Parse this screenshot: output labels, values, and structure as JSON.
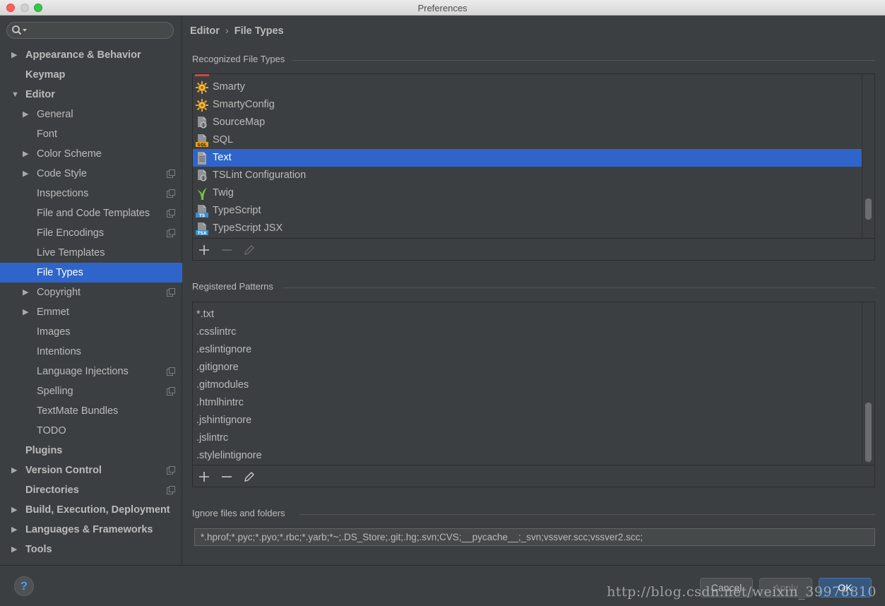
{
  "window": {
    "title": "Preferences"
  },
  "search": {
    "placeholder": ""
  },
  "sidebar": {
    "items": [
      {
        "label": "Appearance & Behavior",
        "level": 0,
        "bold": true,
        "arrow": "right",
        "proj": false
      },
      {
        "label": "Keymap",
        "level": 0,
        "bold": true,
        "arrow": "",
        "proj": false
      },
      {
        "label": "Editor",
        "level": 0,
        "bold": true,
        "arrow": "down",
        "proj": false
      },
      {
        "label": "General",
        "level": 1,
        "bold": false,
        "arrow": "right",
        "proj": false
      },
      {
        "label": "Font",
        "level": 1,
        "bold": false,
        "arrow": "",
        "proj": false
      },
      {
        "label": "Color Scheme",
        "level": 1,
        "bold": false,
        "arrow": "right",
        "proj": false
      },
      {
        "label": "Code Style",
        "level": 1,
        "bold": false,
        "arrow": "right",
        "proj": true
      },
      {
        "label": "Inspections",
        "level": 1,
        "bold": false,
        "arrow": "",
        "proj": true
      },
      {
        "label": "File and Code Templates",
        "level": 1,
        "bold": false,
        "arrow": "",
        "proj": true
      },
      {
        "label": "File Encodings",
        "level": 1,
        "bold": false,
        "arrow": "",
        "proj": true
      },
      {
        "label": "Live Templates",
        "level": 1,
        "bold": false,
        "arrow": "",
        "proj": false
      },
      {
        "label": "File Types",
        "level": 1,
        "bold": false,
        "arrow": "",
        "proj": false,
        "selected": true
      },
      {
        "label": "Copyright",
        "level": 1,
        "bold": false,
        "arrow": "right",
        "proj": true
      },
      {
        "label": "Emmet",
        "level": 1,
        "bold": false,
        "arrow": "right",
        "proj": false
      },
      {
        "label": "Images",
        "level": 1,
        "bold": false,
        "arrow": "",
        "proj": false
      },
      {
        "label": "Intentions",
        "level": 1,
        "bold": false,
        "arrow": "",
        "proj": false
      },
      {
        "label": "Language Injections",
        "level": 1,
        "bold": false,
        "arrow": "",
        "proj": true
      },
      {
        "label": "Spelling",
        "level": 1,
        "bold": false,
        "arrow": "",
        "proj": true
      },
      {
        "label": "TextMate Bundles",
        "level": 1,
        "bold": false,
        "arrow": "",
        "proj": false
      },
      {
        "label": "TODO",
        "level": 1,
        "bold": false,
        "arrow": "",
        "proj": false
      },
      {
        "label": "Plugins",
        "level": 0,
        "bold": true,
        "arrow": "",
        "proj": false
      },
      {
        "label": "Version Control",
        "level": 0,
        "bold": true,
        "arrow": "right",
        "proj": true
      },
      {
        "label": "Directories",
        "level": 0,
        "bold": true,
        "arrow": "",
        "proj": true
      },
      {
        "label": "Build, Execution, Deployment",
        "level": 0,
        "bold": true,
        "arrow": "right",
        "proj": false
      },
      {
        "label": "Languages & Frameworks",
        "level": 0,
        "bold": true,
        "arrow": "right",
        "proj": false
      },
      {
        "label": "Tools",
        "level": 0,
        "bold": true,
        "arrow": "right",
        "proj": false
      }
    ]
  },
  "breadcrumb": {
    "parent": "Editor",
    "separator": "›",
    "current": "File Types"
  },
  "recognized": {
    "title": "Recognized File Types",
    "items": [
      {
        "label": "Smarty",
        "icon": "smarty-icon"
      },
      {
        "label": "SmartyConfig",
        "icon": "smarty-icon"
      },
      {
        "label": "SourceMap",
        "icon": "config-file-icon"
      },
      {
        "label": "SQL",
        "icon": "sql-file-icon"
      },
      {
        "label": "Text",
        "icon": "text-file-icon",
        "selected": true
      },
      {
        "label": "TSLint Configuration",
        "icon": "config-file-icon"
      },
      {
        "label": "Twig",
        "icon": "twig-icon"
      },
      {
        "label": "TypeScript",
        "icon": "ts-file-icon",
        "badge": "TS"
      },
      {
        "label": "TypeScript JSX",
        "icon": "tsx-file-icon",
        "badge": "TSX"
      }
    ]
  },
  "patterns": {
    "title": "Registered Patterns",
    "items": [
      "*.txt",
      ".csslintrc",
      ".eslintignore",
      ".gitignore",
      ".gitmodules",
      ".htmlhintrc",
      ".jshintignore",
      ".jslintrc",
      ".stylelintignore"
    ]
  },
  "ignore": {
    "title": "Ignore files and folders",
    "value": "*.hprof;*.pyc;*.pyo;*.rbc;*.yarb;*~;.DS_Store;.git;.hg;.svn;CVS;__pycache__;_svn;vssver.scc;vssver2.scc;"
  },
  "footer": {
    "help": "?",
    "cancel": "Cancel",
    "apply": "Apply",
    "ok": "OK",
    "watermark": "http://blog.csdn.net/weixin_39978810"
  },
  "colors": {
    "selection": "#2f65ca",
    "panel": "#3c3f41",
    "text": "#bbbbbb"
  }
}
